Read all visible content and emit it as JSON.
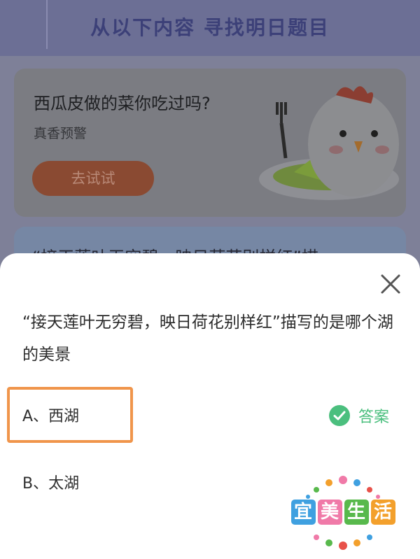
{
  "banner": {
    "title": "从以下内容  寻找明日题目"
  },
  "card": {
    "title": "西瓜皮做的菜你吃过吗?",
    "subtitle": "真香预警",
    "button_label": "去试试"
  },
  "card2": {
    "text": "“接天莲叶无穷碧，映日荷花别样红”描"
  },
  "sheet": {
    "question": "“接天莲叶无穷碧，映日荷花别样红”描写的是哪个湖的美景",
    "options": [
      {
        "label": "A、西湖"
      },
      {
        "label": "B、太湖"
      }
    ],
    "answer_label": "答案",
    "answer_color": "#4bbf7e"
  },
  "logo": {
    "chars": [
      "宜",
      "美",
      "生",
      "活"
    ],
    "colors": [
      "#3fa0e0",
      "#f07aa8",
      "#58b94c",
      "#f3a02c"
    ]
  },
  "icons": {
    "close": "close-icon",
    "answer": "check-circle-icon",
    "mascot": "chicken-mascot-icon"
  }
}
